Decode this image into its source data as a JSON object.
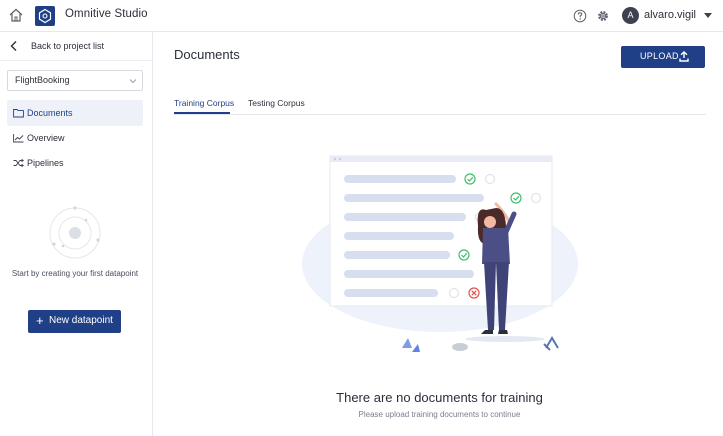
{
  "header": {
    "app_title": "Omnitive Studio",
    "user": {
      "initial": "A",
      "name": "alvaro.vigil"
    },
    "icons": [
      "home-icon",
      "logo-icon",
      "help-icon",
      "gear-icon",
      "caret-down-icon"
    ]
  },
  "sidebar": {
    "back_label": "Back to project list",
    "project_select": {
      "value": "FlightBooking"
    },
    "nav": [
      {
        "label": "Documents",
        "icon": "folder-icon",
        "active": true
      },
      {
        "label": "Overview",
        "icon": "chart-line-icon",
        "active": false
      },
      {
        "label": "Pipelines",
        "icon": "shuffle-icon",
        "active": false
      }
    ],
    "empty_hint": "Start by creating your first datapoint",
    "new_datapoint": {
      "plus": "+",
      "label": "New datapoint"
    }
  },
  "main": {
    "title": "Documents",
    "upload_label": "UPLOAD",
    "tabs": [
      {
        "label": "Training Corpus",
        "active": true
      },
      {
        "label": "Testing Corpus",
        "active": false
      }
    ],
    "empty_state": {
      "title": "There are no documents for training",
      "subtitle": "Please upload training documents to continue"
    }
  },
  "colors": {
    "primary": "#1f3f86",
    "active_nav_bg": "#eef1f7",
    "illustration_bg": "#eef2fb",
    "check_green": "#3fbf6a",
    "cross_red": "#e05252"
  }
}
